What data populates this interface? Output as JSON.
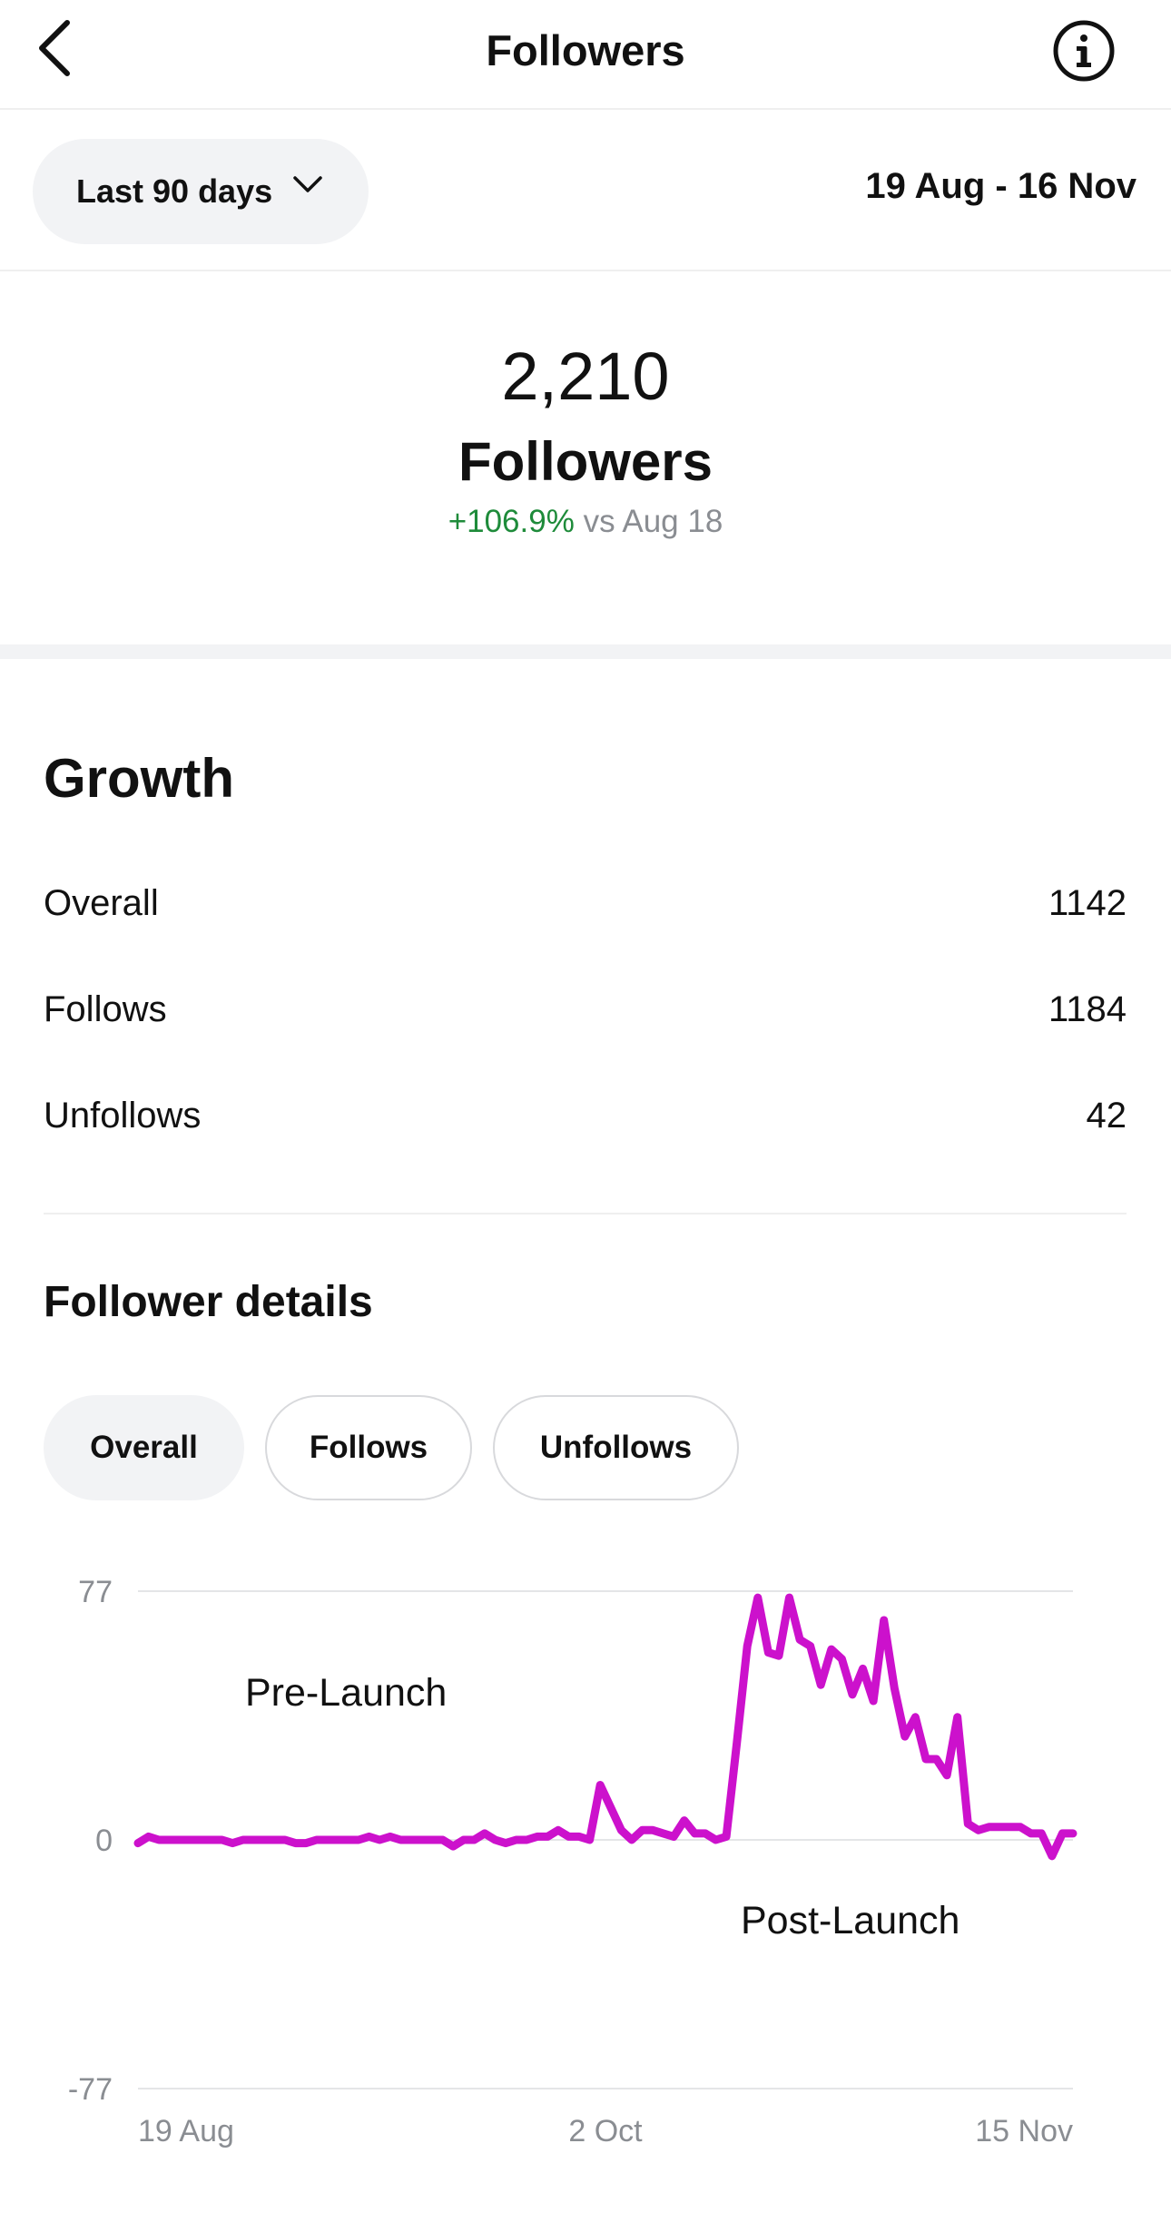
{
  "header": {
    "title": "Followers",
    "back_icon": "chevron-left-icon",
    "info_icon": "info-circle-icon"
  },
  "filter": {
    "range_label": "Last 90 days",
    "date_range": "19 Aug - 16 Nov"
  },
  "summary": {
    "count": "2,210",
    "label": "Followers",
    "change_pct": "+106.9%",
    "change_ref": "vs Aug 18"
  },
  "growth": {
    "title": "Growth",
    "rows": [
      {
        "label": "Overall",
        "value": "1142"
      },
      {
        "label": "Follows",
        "value": "1184"
      },
      {
        "label": "Unfollows",
        "value": "42"
      }
    ]
  },
  "details": {
    "title": "Follower details",
    "tabs": [
      {
        "label": "Overall",
        "active": true
      },
      {
        "label": "Follows",
        "active": false
      },
      {
        "label": "Unfollows",
        "active": false
      }
    ]
  },
  "colors": {
    "line": "#cc11cc",
    "positive": "#1e8b3a",
    "muted": "#8a8d92"
  },
  "chart_data": {
    "type": "line",
    "y_ticks": [
      "77",
      "0",
      "-77"
    ],
    "ylim": [
      -77,
      77
    ],
    "x_tick_labels": [
      "19 Aug",
      "2 Oct",
      "15 Nov"
    ],
    "annotations": [
      "Pre-Launch",
      "Post-Launch"
    ],
    "grid": true,
    "series": [
      {
        "values": [
          -1,
          1,
          0,
          0,
          0,
          0,
          0,
          0,
          0,
          -1,
          0,
          0,
          0,
          0,
          0,
          -1,
          -1,
          0,
          0,
          0,
          0,
          0,
          1,
          0,
          1,
          0,
          0,
          0,
          0,
          0,
          -2,
          0,
          0,
          2,
          0,
          -1,
          0,
          0,
          1,
          1,
          3,
          1,
          1,
          0,
          17,
          10,
          3,
          0,
          3,
          3,
          2,
          1,
          6,
          2,
          2,
          0,
          1,
          30,
          60,
          75,
          58,
          57,
          75,
          62,
          60,
          48,
          59,
          56,
          45,
          53,
          43,
          68,
          47,
          32,
          38,
          25,
          25,
          20,
          38,
          5,
          3,
          4,
          4,
          4,
          4,
          2,
          2,
          -5,
          2,
          2
        ]
      }
    ]
  }
}
